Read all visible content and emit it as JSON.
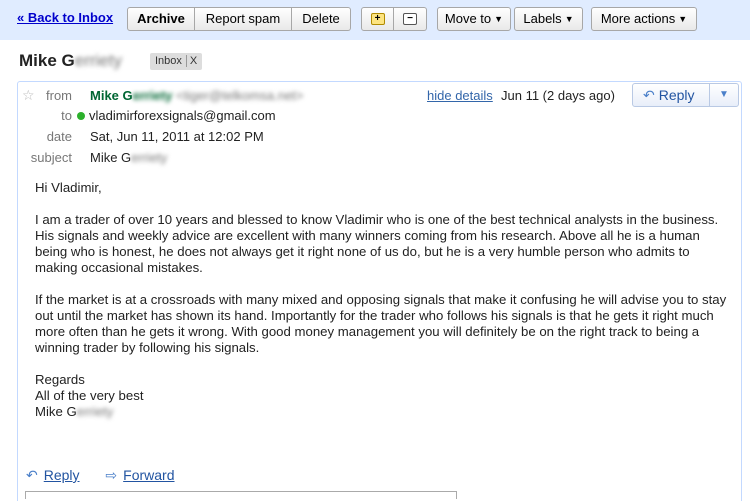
{
  "toolbar": {
    "back": "« Back to Inbox",
    "archive": "Archive",
    "report_spam": "Report spam",
    "delete": "Delete",
    "move_to": "Move to",
    "labels": "Labels",
    "more_actions": "More actions"
  },
  "thread": {
    "subject_visible": "Mike G",
    "subject_obscured": "erriety",
    "label": "Inbox",
    "label_remove": "X"
  },
  "message": {
    "labels": {
      "from": "from",
      "to": "to",
      "date": "date",
      "subject": "subject"
    },
    "from_name_visible": "Mike G",
    "from_name_obscured": "erriety",
    "from_email_obscured": "<tiger@telkomsa.net>",
    "to_email": "vladimirforexsignals@gmail.com",
    "date": "Sat, Jun 11, 2011 at 12:02 PM",
    "subject_visible": "Mike G",
    "subject_obscured": "erriety",
    "hide_details": "hide details",
    "received": "Jun 11 (2 days ago)",
    "reply": "Reply",
    "body": {
      "greeting": "Hi Vladimir,",
      "p1": "I am a trader of over 10 years and blessed to know Vladimir who is one of the best technical analysts in the business. His signals and weekly advice are excellent with many winners coming from his research. Above all he is a human being who is honest, he does not always get it right none of us do, but he is a very humble person who admits to making occasional mistakes.",
      "p2": "If the market is at a crossroads with many mixed and opposing signals that make it confusing he will advise you to stay out until the market has shown its hand. Importantly for the trader who follows his signals is that he gets it right much more often than he gets it wrong. With good money management you will definitely be on the right track to being  a winning trader by following his signals.",
      "sign1": "Regards",
      "sign2": "All of the very best",
      "sign3_visible": "Mike G",
      "sign3_obscured": "erriety"
    },
    "footer": {
      "reply": "Reply",
      "forward": "Forward"
    }
  },
  "colors": {
    "toolbar_bg": "#e0ecff",
    "link": "#0000cc",
    "sender": "#006633",
    "online": "#2cb12c"
  }
}
